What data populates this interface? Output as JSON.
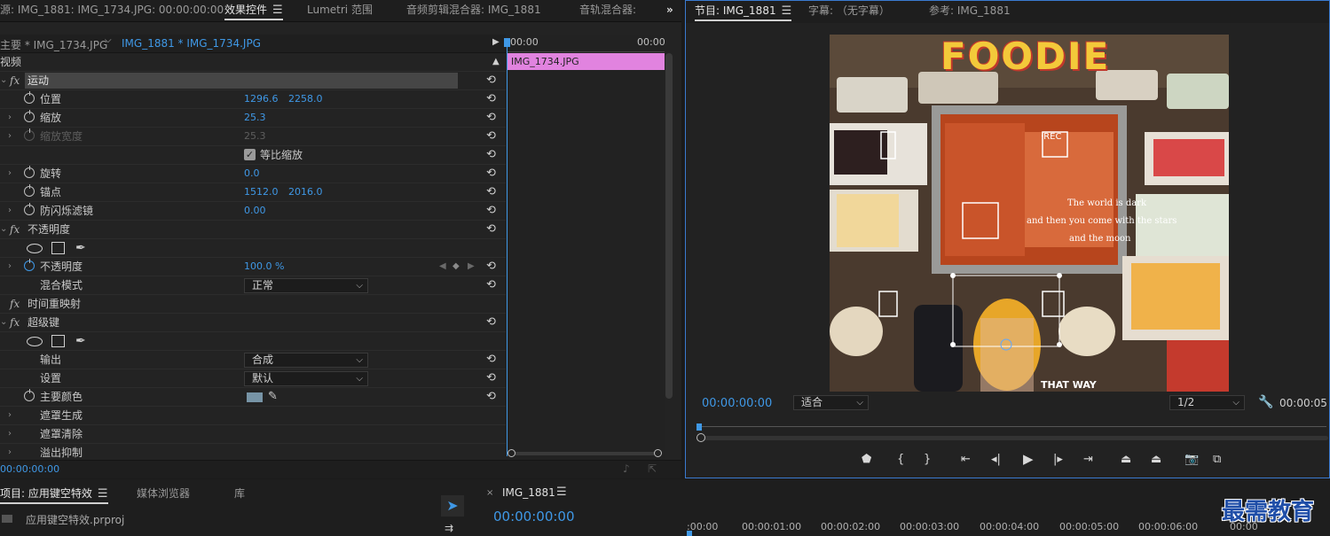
{
  "effect_panel": {
    "tabs": [
      {
        "label": "源: IMG_1881: IMG_1734.JPG: 00:00:00:00"
      },
      {
        "label": "效果控件"
      },
      {
        "label": "Lumetri 范围"
      },
      {
        "label": "音频剪辑混合器: IMG_1881"
      },
      {
        "label": "音轨混合器:"
      }
    ],
    "more": "»",
    "source_master": "主要 * IMG_1734.JPG",
    "source_clip": "IMG_1881 * IMG_1734.JPG",
    "time_start": "00:00",
    "time_end": "00:00",
    "clip_name": "IMG_1734.JPG",
    "video_header": "视频",
    "current_time": "00:00:00:00",
    "rows": {
      "motion": "运动",
      "position": "位置",
      "position_x": "1296.6",
      "position_y": "2258.0",
      "scale": "缩放",
      "scale_val": "25.3",
      "scale_width": "缩放宽度",
      "scale_width_val": "25.3",
      "uniform_scale": "等比缩放",
      "rotation": "旋转",
      "rotation_val": "0.0",
      "anchor": "锚点",
      "anchor_x": "1512.0",
      "anchor_y": "2016.0",
      "flicker": "防闪烁滤镜",
      "flicker_val": "0.00",
      "opacity_fx": "不透明度",
      "opacity": "不透明度",
      "opacity_val": "100.0 %",
      "blend": "混合模式",
      "blend_val": "正常",
      "time_remap": "时间重映射",
      "ultra_key": "超级键",
      "output": "输出",
      "output_val": "合成",
      "setting": "设置",
      "setting_val": "默认",
      "key_color": "主要颜色",
      "matte_gen": "遮罩生成",
      "matte_clean": "遮罩清除",
      "spill": "溢出抑制"
    }
  },
  "program": {
    "tabs": [
      {
        "label": "节目: IMG_1881"
      },
      {
        "label": "字幕: （无字幕）"
      },
      {
        "label": "参考: IMG_1881"
      }
    ],
    "timecode": "00:00:00:00",
    "fit": "适合",
    "res": "1/2",
    "duration": "00:00:05",
    "image": {
      "title": "FOODIE",
      "rec": "·REC",
      "quote1": "The world is dark",
      "quote2": "and then you come with the stars",
      "quote3": "and the moon",
      "bottom_text": "THAT WAY"
    }
  },
  "project": {
    "tabs": [
      {
        "label": "项目: 应用键空特效"
      },
      {
        "label": "媒体浏览器"
      },
      {
        "label": "库"
      }
    ],
    "file": "应用键空特效.prproj"
  },
  "timeline": {
    "tab": "IMG_1881",
    "close": "×",
    "timecode": "00:00:00:00",
    "ruler": [
      ":00:00",
      "00:00:01:00",
      "00:00:02:00",
      "00:00:03:00",
      "00:00:04:00",
      "00:00:05:00",
      "00:00:06:00",
      "00:00"
    ]
  },
  "watermark": "最需教育",
  "colors": {
    "accent": "#3f98e6",
    "clip": "#e183df",
    "key_color": "#7794a6"
  }
}
